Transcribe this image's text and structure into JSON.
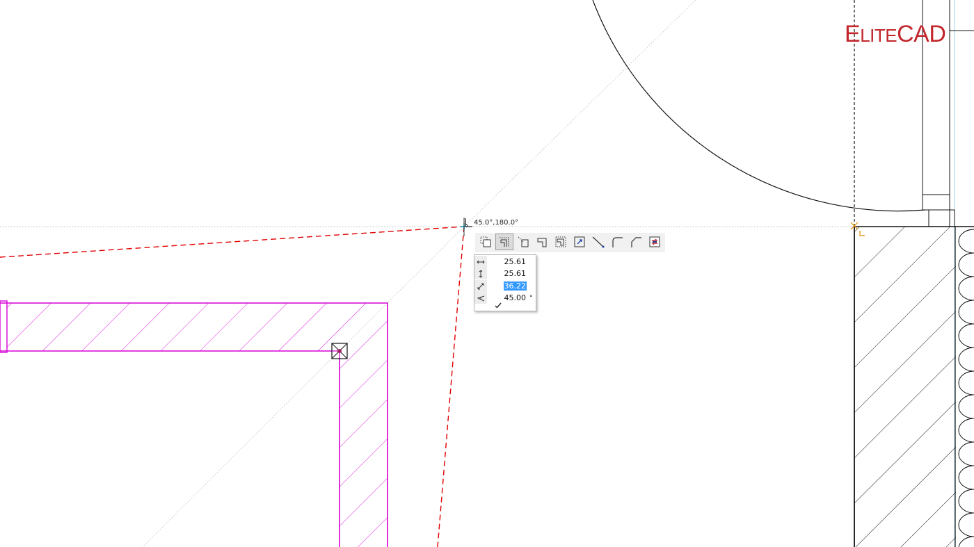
{
  "logo": {
    "first_letter": "E",
    "small_part": "LITE",
    "rest": "CAD"
  },
  "snap_info": {
    "icon": "angle-snap-icon",
    "text": "45.0°,180.0°"
  },
  "toolbar": {
    "buttons": [
      {
        "name": "corner-mode-1-icon",
        "active": false
      },
      {
        "name": "corner-mode-2-icon",
        "active": true
      },
      {
        "name": "corner-mode-3-icon",
        "active": false
      },
      {
        "name": "corner-mode-4-icon",
        "active": false
      },
      {
        "name": "corner-mode-5-icon",
        "active": false
      },
      {
        "name": "corner-mode-6-icon",
        "active": false
      },
      {
        "name": "diagonal-line-icon",
        "active": false
      },
      {
        "name": "round-corner-icon",
        "active": false
      },
      {
        "name": "bevel-corner-icon",
        "active": false
      },
      {
        "name": "swap-icon",
        "active": false
      }
    ]
  },
  "input_panel": {
    "dx": {
      "icon": "horizontal-distance-icon",
      "value": "25.61"
    },
    "dy": {
      "icon": "vertical-distance-icon",
      "value": "25.61"
    },
    "length": {
      "icon": "diagonal-length-icon",
      "value": "36.22"
    },
    "angle": {
      "icon": "angle-icon",
      "value": "45.00",
      "unit": "°"
    },
    "confirm_icon": "checkmark-icon"
  },
  "colors": {
    "background": "#ffffff",
    "wall": "#d600d6",
    "dashed_preview": "#e00000",
    "logo": "#c1272d",
    "guide": "#b0b0b0",
    "selection": "#3399ff",
    "snap_marker": "#e08a00"
  }
}
